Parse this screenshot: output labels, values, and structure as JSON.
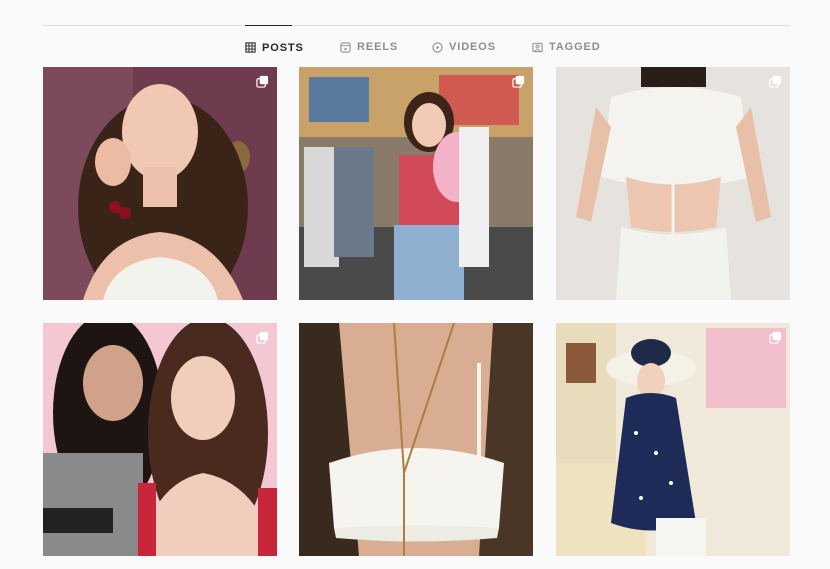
{
  "tabs": [
    {
      "label": "POSTS",
      "icon": "grid-icon",
      "active": true
    },
    {
      "label": "REELS",
      "icon": "reels-icon",
      "active": false
    },
    {
      "label": "VIDEOS",
      "icon": "play-icon",
      "active": false
    },
    {
      "label": "TAGGED",
      "icon": "tag-icon",
      "active": false
    }
  ],
  "posts": [
    {
      "subject": "selfie-cherries",
      "multi": true
    },
    {
      "subject": "cotton-candy-fair",
      "multi": true
    },
    {
      "subject": "white-crop-top",
      "multi": true
    },
    {
      "subject": "two-friends-pink",
      "multi": true
    },
    {
      "subject": "white-lace-top",
      "multi": false
    },
    {
      "subject": "polka-dot-dress-hat",
      "multi": true
    }
  ],
  "colors": {
    "background": "#fafafa",
    "divider": "#dbdbdb",
    "tab_active": "#262626",
    "tab_inactive": "#8e8e8e"
  }
}
